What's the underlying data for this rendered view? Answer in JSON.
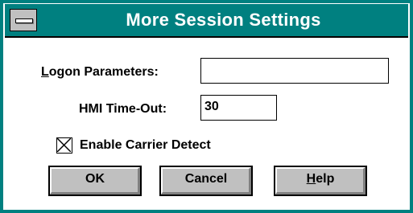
{
  "window": {
    "title": "More Session Settings"
  },
  "logon": {
    "label_mnemonic": "L",
    "label_rest": "ogon Parameters:",
    "value": ""
  },
  "hmi": {
    "label": "HMI Time-Out:",
    "value": "30"
  },
  "carrier": {
    "label": "Enable Carrier Detect",
    "checked": true
  },
  "buttons": {
    "ok": "OK",
    "cancel": "Cancel",
    "help_mnemonic": "H",
    "help_rest": "elp"
  },
  "colors": {
    "titlebar": "#008080",
    "button_face": "#c0c0c0"
  }
}
